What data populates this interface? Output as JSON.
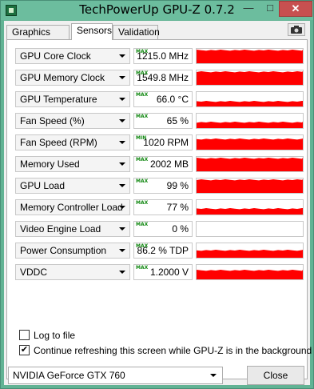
{
  "window": {
    "title": "TechPowerUp GPU-Z 0.7.2",
    "minimize_glyph": "—",
    "maximize_glyph": "□",
    "close_glyph": "✕"
  },
  "tabs": [
    {
      "label": "Graphics Card"
    },
    {
      "label": "Sensors"
    },
    {
      "label": "Validation"
    }
  ],
  "sensors": [
    {
      "name": "GPU Core Clock",
      "tag": "MAX",
      "value": "1215.0 MHz",
      "level": 0.97
    },
    {
      "name": "GPU Memory Clock",
      "tag": "MAX",
      "value": "1549.8 MHz",
      "level": 0.97
    },
    {
      "name": "GPU Temperature",
      "tag": "MAX",
      "value": "66.0 °C",
      "level": 0.4
    },
    {
      "name": "Fan Speed (%)",
      "tag": "MAX",
      "value": "65 %",
      "level": 0.45
    },
    {
      "name": "Fan Speed (RPM)",
      "tag": "MIN",
      "value": "1020 RPM",
      "level": 0.75
    },
    {
      "name": "Memory Used",
      "tag": "MAX",
      "value": "2002 MB",
      "level": 0.95
    },
    {
      "name": "GPU Load",
      "tag": "MAX",
      "value": "99 %",
      "level": 0.95
    },
    {
      "name": "Memory Controller Load",
      "tag": "MAX",
      "value": "77 %",
      "level": 0.45
    },
    {
      "name": "Video Engine Load",
      "tag": "MAX",
      "value": "0 %",
      "level": 0
    },
    {
      "name": "Power Consumption",
      "tag": "MAX",
      "value": "86.2 % TDP",
      "level": 0.55
    },
    {
      "name": "VDDC",
      "tag": "MAX",
      "value": "1.2000 V",
      "level": 0.65
    }
  ],
  "options": {
    "log_to_file": {
      "label": "Log to file",
      "checked": false,
      "mark": ""
    },
    "continue_refresh": {
      "label": "Continue refreshing this screen while GPU-Z is in the background",
      "checked": true,
      "mark": "✔"
    }
  },
  "footer": {
    "gpu_selected": "NVIDIA GeForce GTX 760",
    "close_label": "Close"
  },
  "colors": {
    "graph": "#ff0000",
    "tag": "#118811",
    "frame": "#62b394"
  },
  "icons": {
    "camera": "camera-icon",
    "app": "gpu-z-app-icon"
  }
}
